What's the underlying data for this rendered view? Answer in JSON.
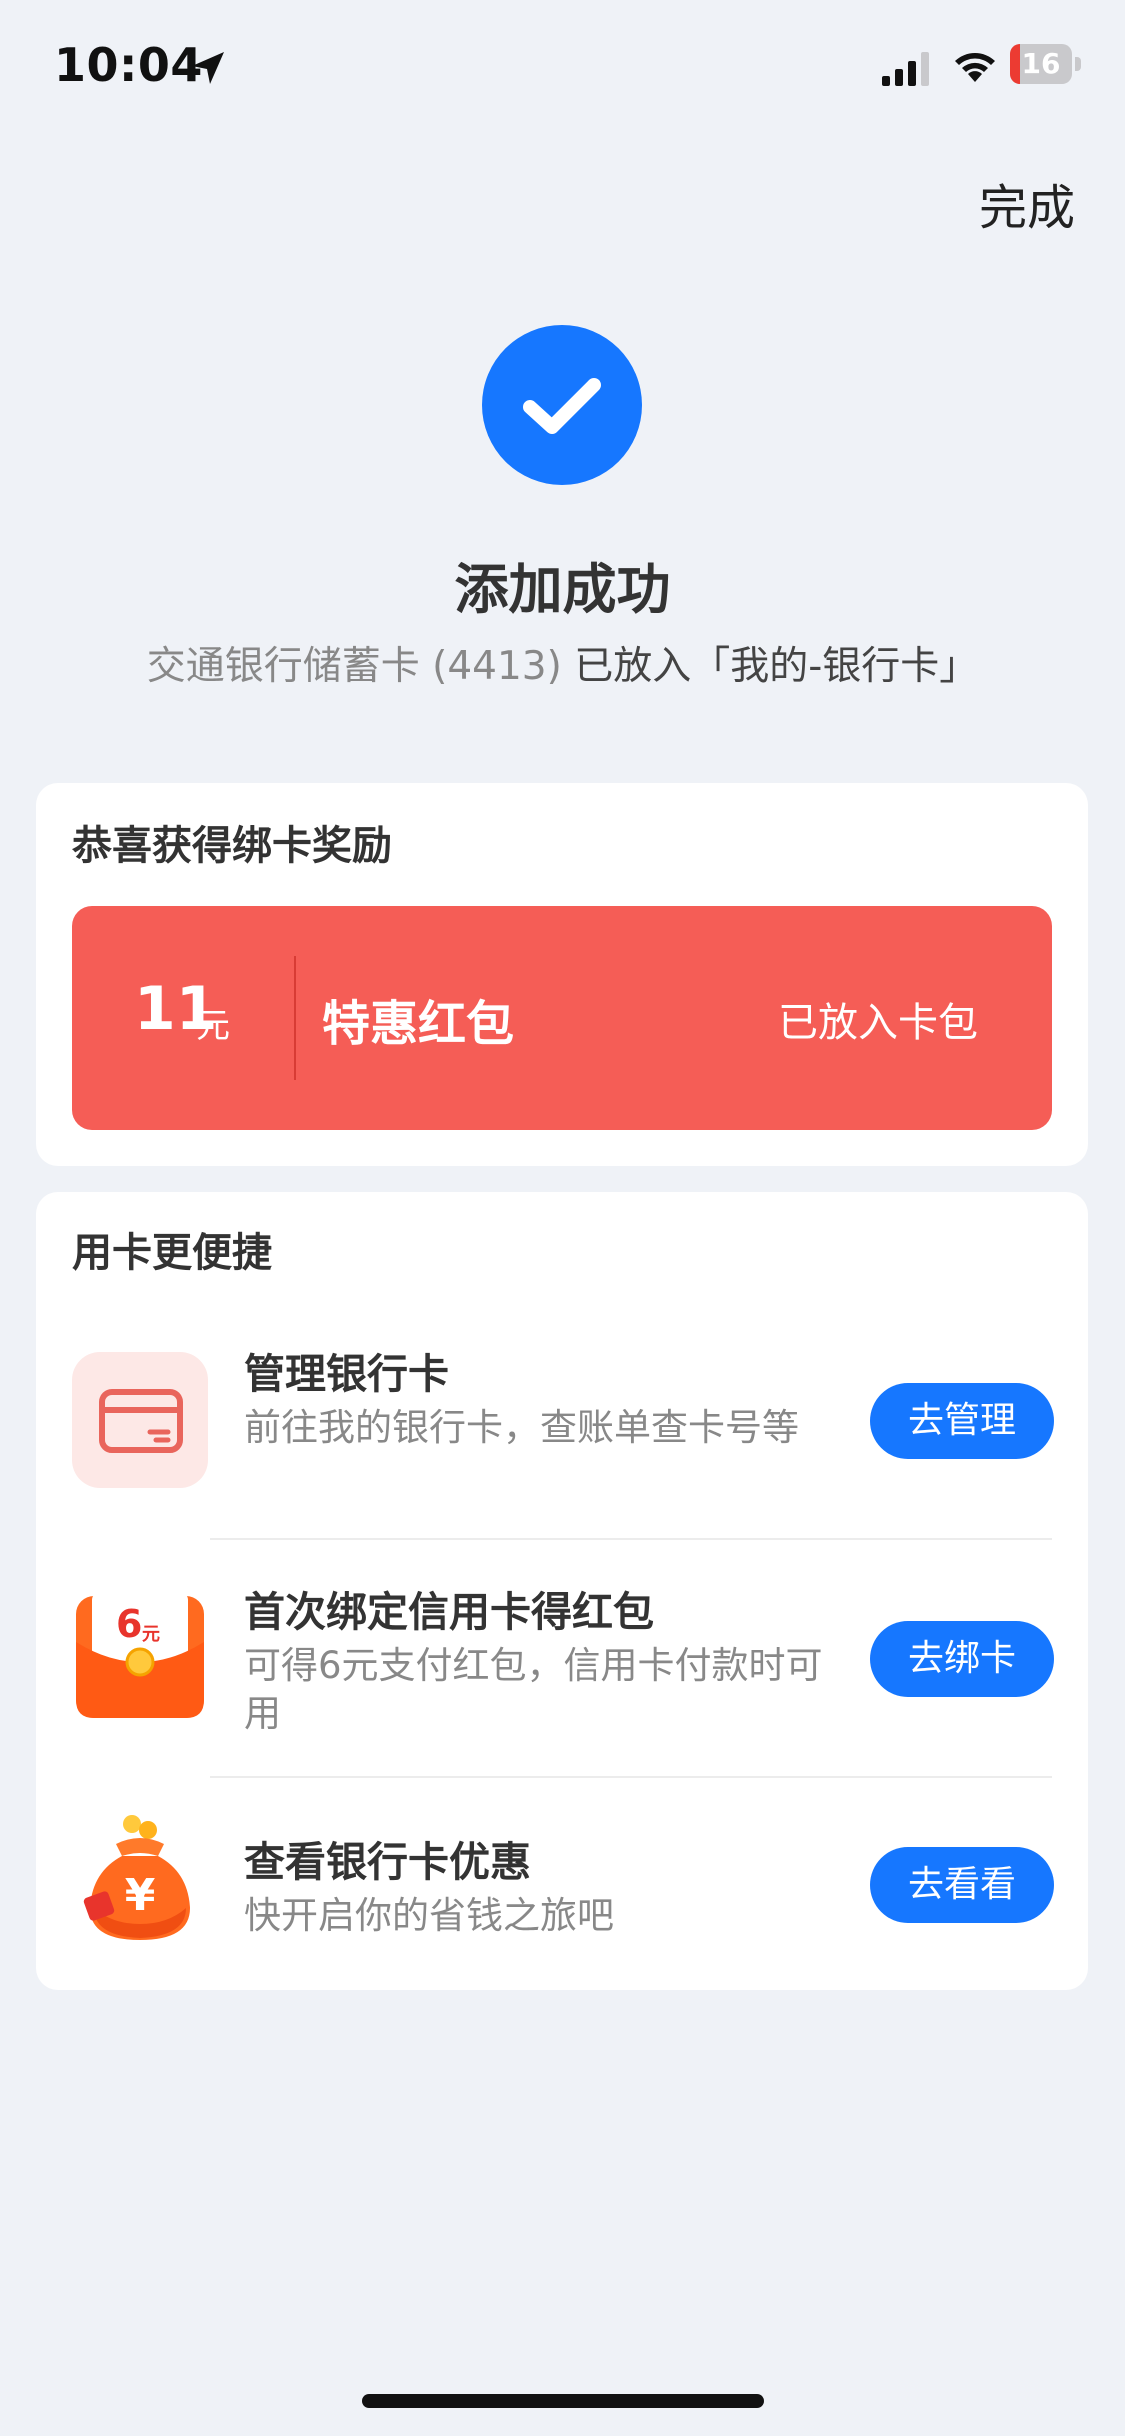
{
  "status_bar": {
    "time": "10:04",
    "battery": "16",
    "battery_level": 0.16
  },
  "header": {
    "done_label": "完成"
  },
  "result": {
    "title": "添加成功",
    "subtitle_card": "交通银行储蓄卡 (4413)",
    "subtitle_dest": "已放入「我的-银行卡」"
  },
  "reward": {
    "section_title": "恭喜获得绑卡奖励",
    "amount": "11",
    "unit": "元",
    "name": "特惠红包",
    "status": "已放入卡包"
  },
  "convenience": {
    "section_title": "用卡更便捷",
    "items": [
      {
        "icon": "bank-card-icon",
        "title": "管理银行卡",
        "desc": "前往我的银行卡，查账单查卡号等",
        "button": "去管理"
      },
      {
        "icon": "red-envelope-icon",
        "badge": "6",
        "badge_unit": "元",
        "title": "首次绑定信用卡得红包",
        "desc": "可得6元支付红包，信用卡付款时可用",
        "button": "去绑卡"
      },
      {
        "icon": "money-bag-icon",
        "title": "查看银行卡优惠",
        "desc": "快开启你的省钱之旅吧",
        "button": "去看看"
      }
    ]
  },
  "colors": {
    "accent": "#1677ff",
    "coupon": "#f55d56",
    "background": "#eff2f7"
  }
}
